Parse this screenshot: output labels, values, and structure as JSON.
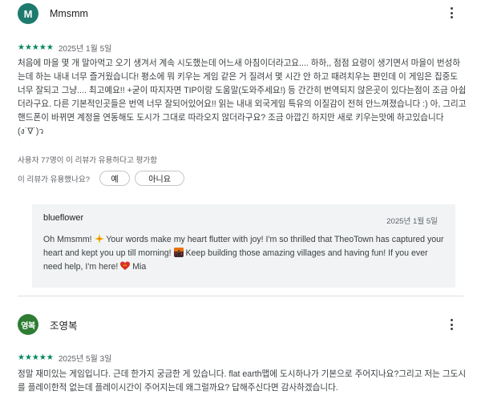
{
  "reviews": [
    {
      "avatar_letter": "M",
      "avatar_color": "#1e7a6e",
      "author": "Mmsmm",
      "stars": "★★★★★",
      "date": "2025년 1월 5일",
      "text": "처음에 마을 몇 개 말아먹고 오기 생겨서 계속 시도했는데 어느새 아침이더라고요.... 하하,, 점점 요령이 생기면서 마을이 번성하는데 하는 내내 너무 즐거웠습니다! 평소에 뭐 키우는 게임 같은 거 질려서 몇 시간 안 하고 때려치우는 편인데 이 게임은 집중도 너무 잘되고 그냥.... 최고예요!! +굳이 따지자면 TIP이랑 도움말(도와주세요!) 등 간간히 번역되지 않은곳이 있다는점이 조금 아쉽더라구요. 다른 기본적인곳들은 번역 너무 잘되어있어요!! 읽는 내내 외국게임 특유의 이질감이 전혀 안느껴졌습니다 :) 아, 그리고 핸드폰이 바뀌면 계정을 연동해도 도시가 그대로 따라오지 않더라구요? 조금 아깝긴 하지만 새로 키우는맛에 하고있습니다(ง˙∇˙)ว",
      "helpful_count": "사용자 77명이 이 리뷰가 유용하다고 평가함",
      "helpful_question": "이 리뷰가 유용했나요?",
      "yes_label": "예",
      "no_label": "아니요",
      "reply": {
        "author": "blueflower",
        "date": "2025년 1월 5일",
        "segments": [
          "Oh Mmsmm! ",
          " Your words make my heart flutter with joy! I'm so thrilled that TheoTown has captured your heart and kept you up till morning! ",
          " Keep building those amazing villages and having fun! If you ever need help, I'm here! ",
          " Mia"
        ],
        "emoji_icons": [
          "sparkle-icon",
          "city-sunset-icon",
          "heart-ribbon-icon"
        ]
      }
    },
    {
      "avatar_letter": "영복",
      "avatar_color": "#2e7d32",
      "author": "조영복",
      "stars": "★★★★★",
      "date": "2025년 5월 3일",
      "text": "정말 재미있는 게임입니다. 근데 한가지 궁금한 게 있습니다. flat earth맵에 도시하나가 기본으로 주어지나요?그리고 저는 그도시를 플레이한적 없는데 플레이시간이 주어지는데 왜그럴까요? 답해주신다면 감사하겠습니다."
    }
  ]
}
